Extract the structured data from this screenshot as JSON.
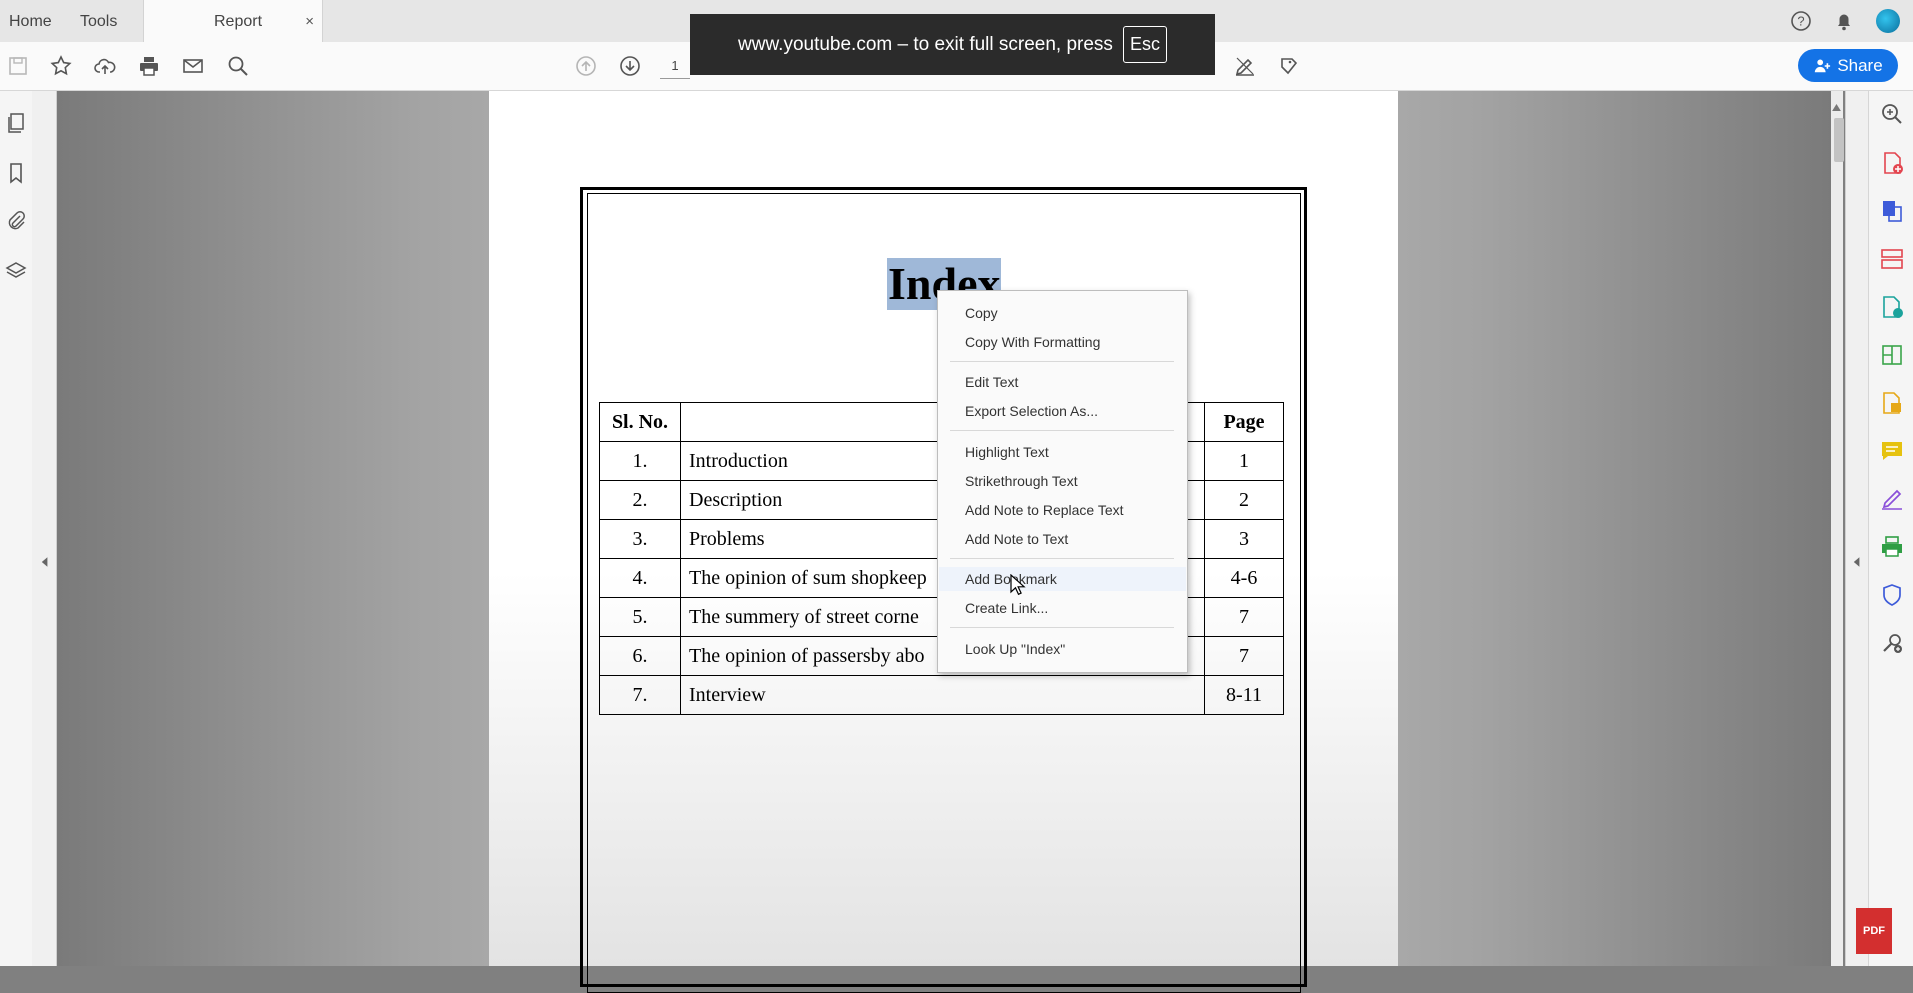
{
  "tabs": {
    "home": "Home",
    "tools": "Tools",
    "document": "Report",
    "close": "×"
  },
  "toolbar": {
    "page_number": "1",
    "share_label": "Share"
  },
  "toast": {
    "message": "www.youtube.com – to exit full screen, press",
    "key": "Esc"
  },
  "document": {
    "title": "Index",
    "table": {
      "headers": [
        "Sl. No.",
        "",
        "Page"
      ],
      "rows": [
        {
          "no": "1.",
          "topic": "Introduction",
          "page": "1"
        },
        {
          "no": "2.",
          "topic": "Description",
          "page": "2"
        },
        {
          "no": "3.",
          "topic": "Problems",
          "page": "3"
        },
        {
          "no": "4.",
          "topic": "The opinion of sum shopkeep",
          "page": "4-6"
        },
        {
          "no": "5.",
          "topic": "The summery of street corne",
          "page": "7"
        },
        {
          "no": "6.",
          "topic": "The opinion of passersby abo",
          "page": "7"
        },
        {
          "no": "7.",
          "topic": "Interview",
          "page": "8-11"
        }
      ]
    }
  },
  "context_menu": {
    "items": [
      "Copy",
      "Copy With Formatting",
      "Edit Text",
      "Export Selection As...",
      "Highlight Text",
      "Strikethrough Text",
      "Add Note to Replace Text",
      "Add Note to Text",
      "Add Bookmark",
      "Create Link...",
      "Look Up \"Index\""
    ]
  },
  "badge": "PDF",
  "colors": {
    "accent": "#1473e6",
    "selection": "#9fb8d8",
    "pdf_badge": "#d32f2f"
  },
  "icons": {
    "toolbar": [
      "save-icon",
      "star-icon",
      "upload-cloud-icon",
      "print-icon",
      "mail-icon",
      "zoom-search-icon",
      "page-up-icon",
      "page-down-icon",
      "sign-pen-icon",
      "stamp-icon"
    ],
    "left_rail": [
      "pages-icon",
      "bookmark-icon",
      "attachment-icon",
      "layers-icon"
    ],
    "right_rail": [
      "zoom-icon",
      "create-pdf-icon",
      "export-pdf-icon",
      "organize-pages-icon",
      "edit-pdf-icon",
      "combine-icon",
      "scan-icon",
      "comment-icon",
      "fill-sign-icon",
      "print-production-icon",
      "protect-icon",
      "more-tools-icon"
    ]
  }
}
